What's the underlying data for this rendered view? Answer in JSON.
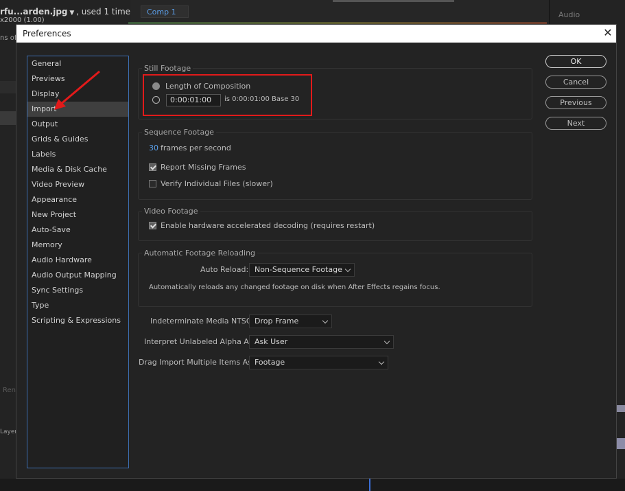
{
  "background": {
    "title_name": "rfu...arden.jpg",
    "title_suffix": ", used 1 time",
    "sub_line": "x2000 (1.00)",
    "sub_line2": "ns of",
    "comp_tab": "Comp 1",
    "audio_label": "Audio",
    "render_label": "Ren",
    "layer_label": "Layer"
  },
  "dialog": {
    "title": "Preferences",
    "close_icon": "close-icon"
  },
  "categories": [
    {
      "label": "General"
    },
    {
      "label": "Previews"
    },
    {
      "label": "Display"
    },
    {
      "label": "Import",
      "selected": true
    },
    {
      "label": "Output"
    },
    {
      "label": "Grids & Guides"
    },
    {
      "label": "Labels"
    },
    {
      "label": "Media & Disk Cache"
    },
    {
      "label": "Video Preview"
    },
    {
      "label": "Appearance"
    },
    {
      "label": "New Project"
    },
    {
      "label": "Auto-Save"
    },
    {
      "label": "Memory"
    },
    {
      "label": "Audio Hardware"
    },
    {
      "label": "Audio Output Mapping"
    },
    {
      "label": "Sync Settings"
    },
    {
      "label": "Type"
    },
    {
      "label": "Scripting & Expressions"
    }
  ],
  "still_footage": {
    "title": "Still Footage",
    "option_length": "Length of Composition",
    "duration_value": "0:00:01:00",
    "duration_info": "is 0:00:01:00  Base 30"
  },
  "sequence_footage": {
    "title": "Sequence Footage",
    "fps_value": "30",
    "fps_label": "frames per second",
    "report_missing": "Report Missing Frames",
    "report_missing_checked": true,
    "verify_files": "Verify Individual Files (slower)",
    "verify_files_checked": false
  },
  "video_footage": {
    "title": "Video Footage",
    "hw_decoding": "Enable hardware accelerated decoding (requires restart)",
    "hw_decoding_checked": true
  },
  "auto_reload": {
    "title": "Automatic Footage Reloading",
    "label": "Auto Reload:",
    "value": "Non-Sequence Footage",
    "description": "Automatically reloads any changed footage on disk when After Effects regains focus."
  },
  "settings": {
    "ntsc_label": "Indeterminate Media NTSC:",
    "ntsc_value": "Drop Frame",
    "alpha_label": "Interpret Unlabeled Alpha As:",
    "alpha_value": "Ask User",
    "drag_label": "Drag Import Multiple Items As:",
    "drag_value": "Footage"
  },
  "buttons": {
    "ok": "OK",
    "cancel": "Cancel",
    "previous": "Previous",
    "next": "Next"
  },
  "colors": {
    "highlight_red": "#e21a1a",
    "accent_blue": "#5aa0ec",
    "list_border": "#3d6fb3"
  }
}
